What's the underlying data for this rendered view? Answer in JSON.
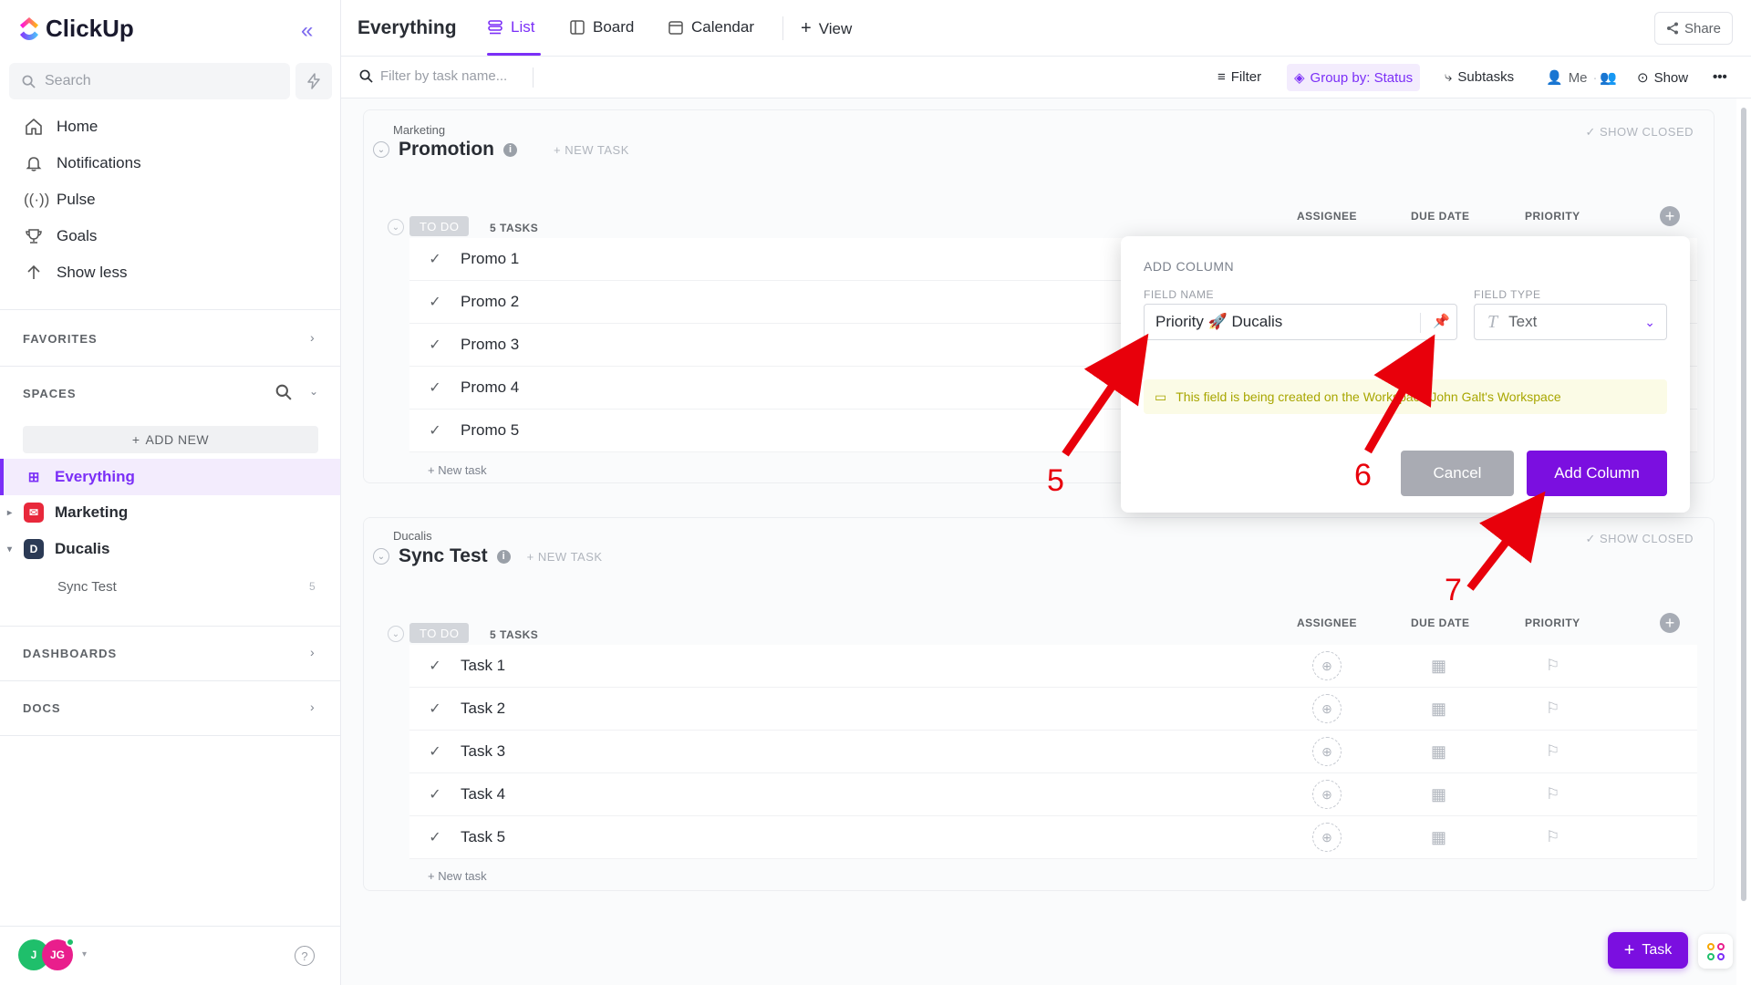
{
  "app": {
    "name": "ClickUp"
  },
  "sidebar": {
    "search_placeholder": "Search",
    "nav": [
      {
        "label": "Home",
        "icon": "home-icon"
      },
      {
        "label": "Notifications",
        "icon": "bell-icon"
      },
      {
        "label": "Pulse",
        "icon": "pulse-icon"
      },
      {
        "label": "Goals",
        "icon": "trophy-icon"
      },
      {
        "label": "Show less",
        "icon": "arrow-up-icon"
      }
    ],
    "favorites_title": "FAVORITES",
    "spaces_title": "SPACES",
    "add_new": "ADD NEW",
    "spaces": [
      {
        "label": "Everything",
        "active": true
      },
      {
        "label": "Marketing",
        "color": "#e8283b"
      },
      {
        "label": "Ducalis",
        "letter": "D",
        "color": "#2b3a55"
      }
    ],
    "sub_list": {
      "label": "Sync Test",
      "count": "5"
    },
    "dashboards_title": "DASHBOARDS",
    "docs_title": "DOCS",
    "avatars": [
      {
        "initial": "J",
        "color": "#1fbf6b"
      },
      {
        "initial": "JG",
        "color": "#e91e8c"
      }
    ]
  },
  "topbar": {
    "title": "Everything",
    "tabs": [
      {
        "label": "List",
        "active": true
      },
      {
        "label": "Board"
      },
      {
        "label": "Calendar"
      },
      {
        "label": "View"
      }
    ],
    "share": "Share"
  },
  "filterbar": {
    "placeholder": "Filter by task name...",
    "filter": "Filter",
    "group_by": "Group by: Status",
    "subtasks": "Subtasks",
    "me": "Me",
    "show": "Show"
  },
  "lists": [
    {
      "space": "Marketing",
      "name": "Promotion",
      "new_task": "+ NEW TASK",
      "show_closed": "SHOW CLOSED",
      "status": "TO DO",
      "count": "5 TASKS",
      "columns": [
        "ASSIGNEE",
        "DUE DATE",
        "PRIORITY"
      ],
      "tasks": [
        "Promo 1",
        "Promo 2",
        "Promo 3",
        "Promo 4",
        "Promo 5"
      ],
      "new_task_row": "+ New task"
    },
    {
      "space": "Ducalis",
      "name": "Sync Test",
      "new_task": "+ NEW TASK",
      "show_closed": "SHOW CLOSED",
      "status": "TO DO",
      "count": "5 TASKS",
      "columns": [
        "ASSIGNEE",
        "DUE DATE",
        "PRIORITY"
      ],
      "tasks": [
        "Task 1",
        "Task 2",
        "Task 3",
        "Task 4",
        "Task 5"
      ],
      "new_task_row": "+ New task"
    }
  ],
  "popup": {
    "title": "ADD COLUMN",
    "field_name_label": "FIELD NAME",
    "field_name_value": "Priority 🚀 Ducalis",
    "field_type_label": "FIELD TYPE",
    "field_type_value": "Text",
    "notice": "This field is being created on the Workspace John Galt's Workspace",
    "cancel": "Cancel",
    "add": "Add Column"
  },
  "fab": {
    "task": "Task"
  },
  "annotations": [
    "5",
    "6",
    "7"
  ],
  "colors": {
    "accent": "#7b2ff7",
    "annotation": "#e8000b"
  }
}
